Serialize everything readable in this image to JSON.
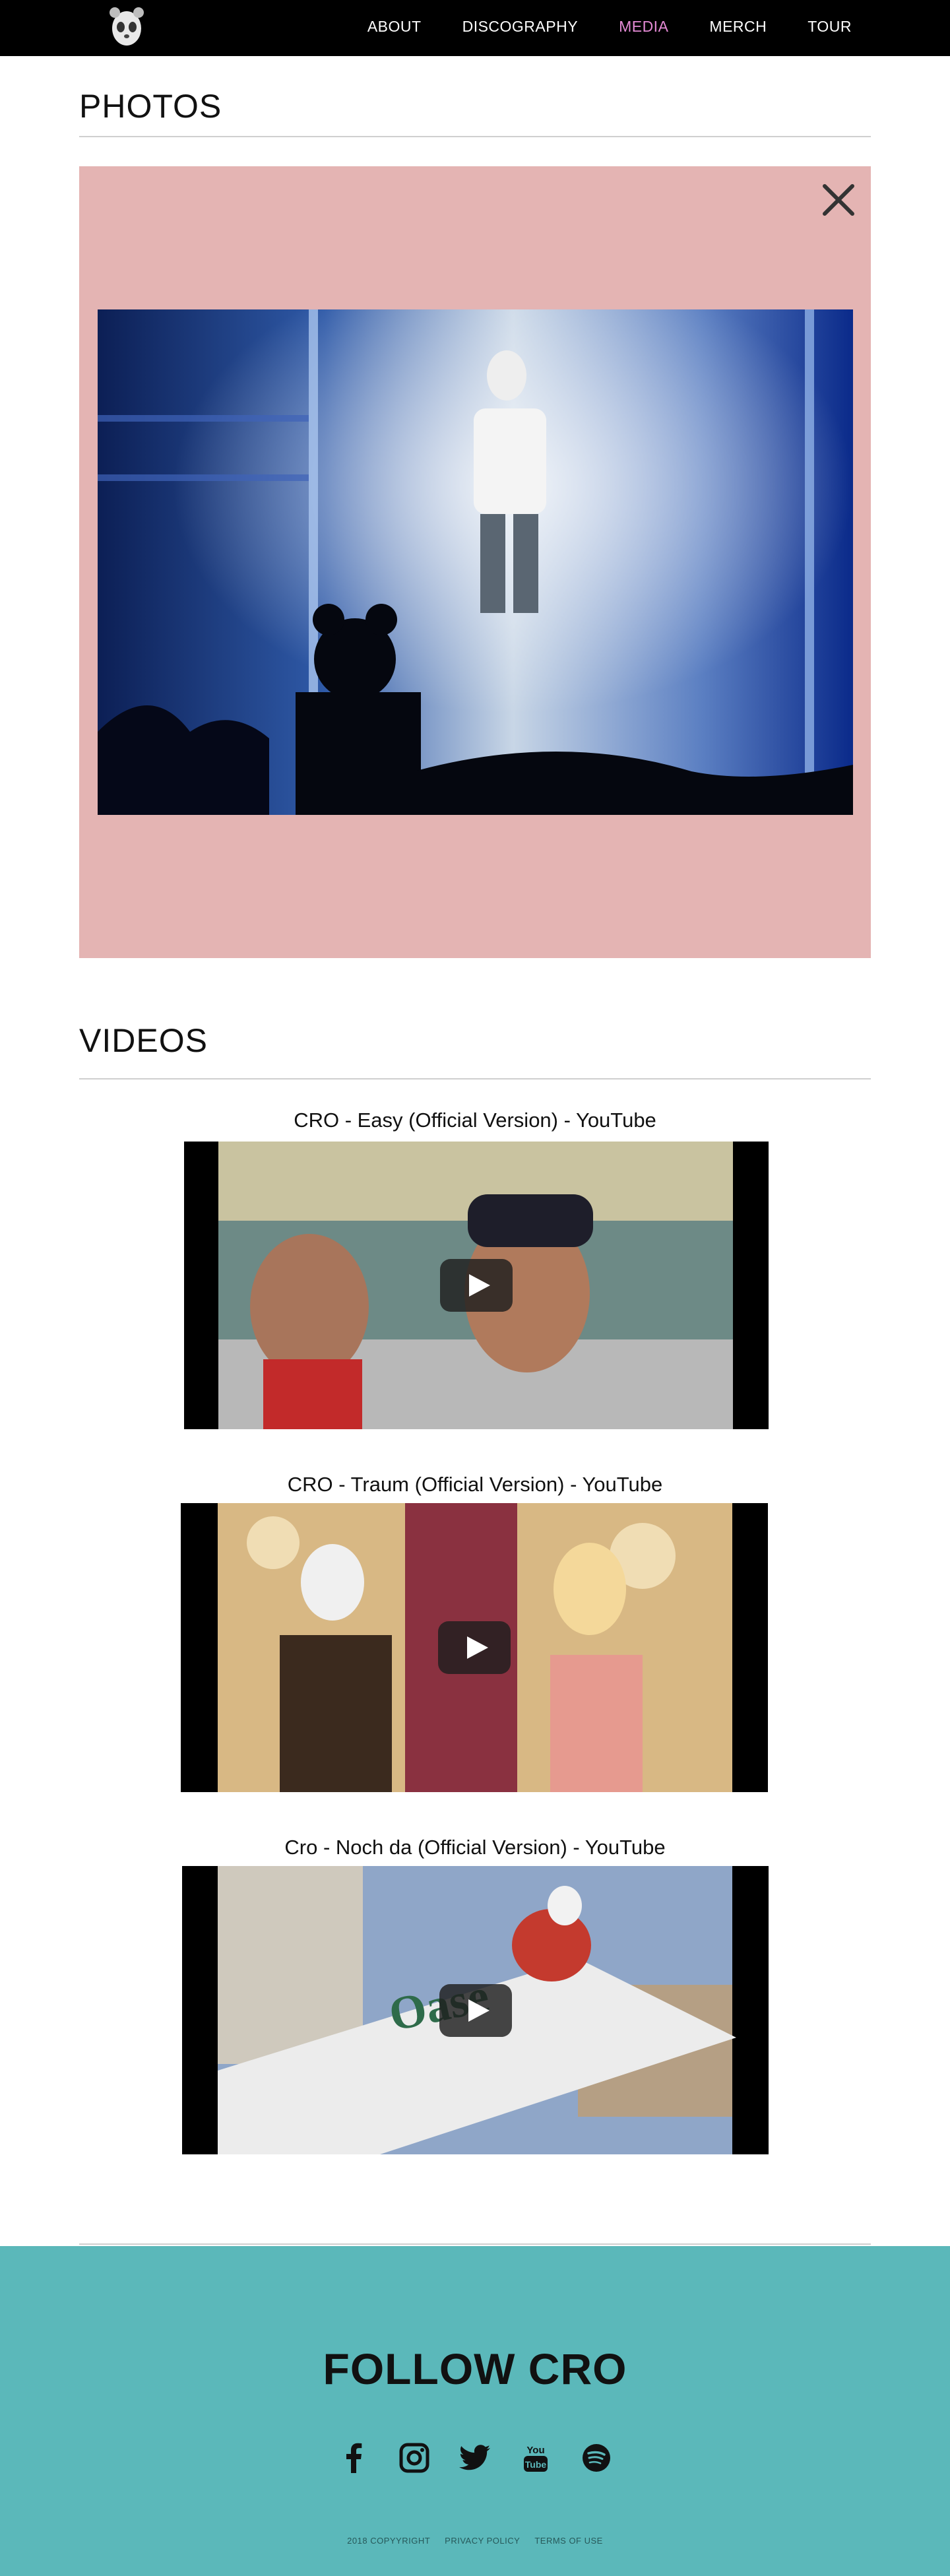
{
  "nav": {
    "items": [
      {
        "label": "ABOUT",
        "active": false
      },
      {
        "label": "DISCOGRAPHY",
        "active": false
      },
      {
        "label": "MEDIA",
        "active": true
      },
      {
        "label": "MERCH",
        "active": false
      },
      {
        "label": "TOUR",
        "active": false
      }
    ],
    "active_color": "#e58bd6"
  },
  "photos": {
    "title": "PHOTOS",
    "lightbox_bg": "#e4b4b3",
    "close_icon": "close-icon"
  },
  "videos": {
    "title": "VIDEOS",
    "items": [
      {
        "title": "CRO - Easy (Official Version) - YouTube"
      },
      {
        "title": "CRO - Traum (Official Version) - YouTube"
      },
      {
        "title": "Cro - Noch da (Official Version) - YouTube"
      }
    ]
  },
  "footer": {
    "title": "FOLLOW CRO",
    "bg": "#5bb8ba",
    "socials": [
      "facebook-icon",
      "instagram-icon",
      "twitter-icon",
      "youtube-icon",
      "spotify-icon"
    ],
    "copyright": "2018 COPYYRIGHT",
    "privacy": "PRIVACY POLICY",
    "terms": "TERMS OF USE"
  }
}
